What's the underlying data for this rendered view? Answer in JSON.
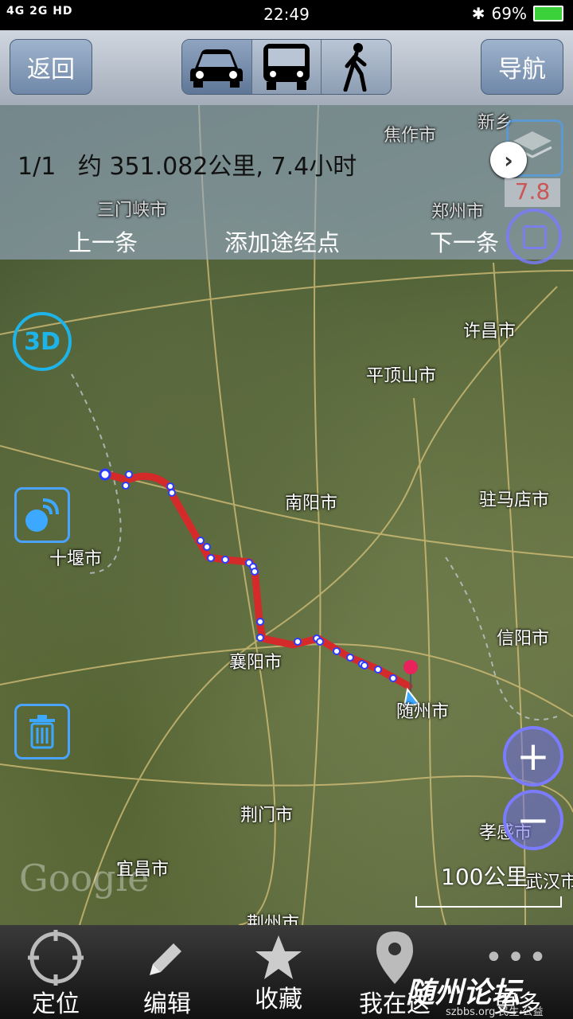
{
  "status": {
    "network": "4G 2G HD",
    "time": "22:49",
    "battery": "69%"
  },
  "toolbar": {
    "back_label": "返回",
    "nav_label": "导航",
    "modes": [
      "car",
      "bus",
      "walk"
    ]
  },
  "route": {
    "index": "1/1",
    "summary": "约 351.082公里, 7.4小时",
    "prev_label": "上一条",
    "add_waypoint_label": "添加途经点",
    "next_label": "下一条"
  },
  "map": {
    "cities": {
      "jiaozuo": "焦作市",
      "sanmenxia": "三门峡市",
      "zhengzhou": "郑州市",
      "xuchang": "许昌市",
      "pingdingshan": "平顶山市",
      "nanyang": "南阳市",
      "zhumadian": "驻马店市",
      "shiyan": "十堰市",
      "xinyang": "信阳市",
      "xiangyang": "襄阳市",
      "suizhou": "随州市",
      "jingmen": "荆门市",
      "xiaogan": "孝感市",
      "yichang": "宜昌市",
      "wuhan": "武汉市",
      "jingzhou": "荆州市",
      "xinxiang_partial": "新乡"
    },
    "label_3d": "3D",
    "scale_label": "100公里",
    "zoom_badge": "7.8",
    "google": "Google"
  },
  "bottom_nav": {
    "locate": "定位",
    "edit": "编辑",
    "favorite": "收藏",
    "here": "我在这",
    "more": "更多"
  },
  "watermark": {
    "title": "随州论坛",
    "sub": "szbbs.org 民生·公益"
  },
  "colors": {
    "route": "#d42a2a",
    "waypoint": "#2a3cff",
    "accent": "#4aa3ff"
  }
}
